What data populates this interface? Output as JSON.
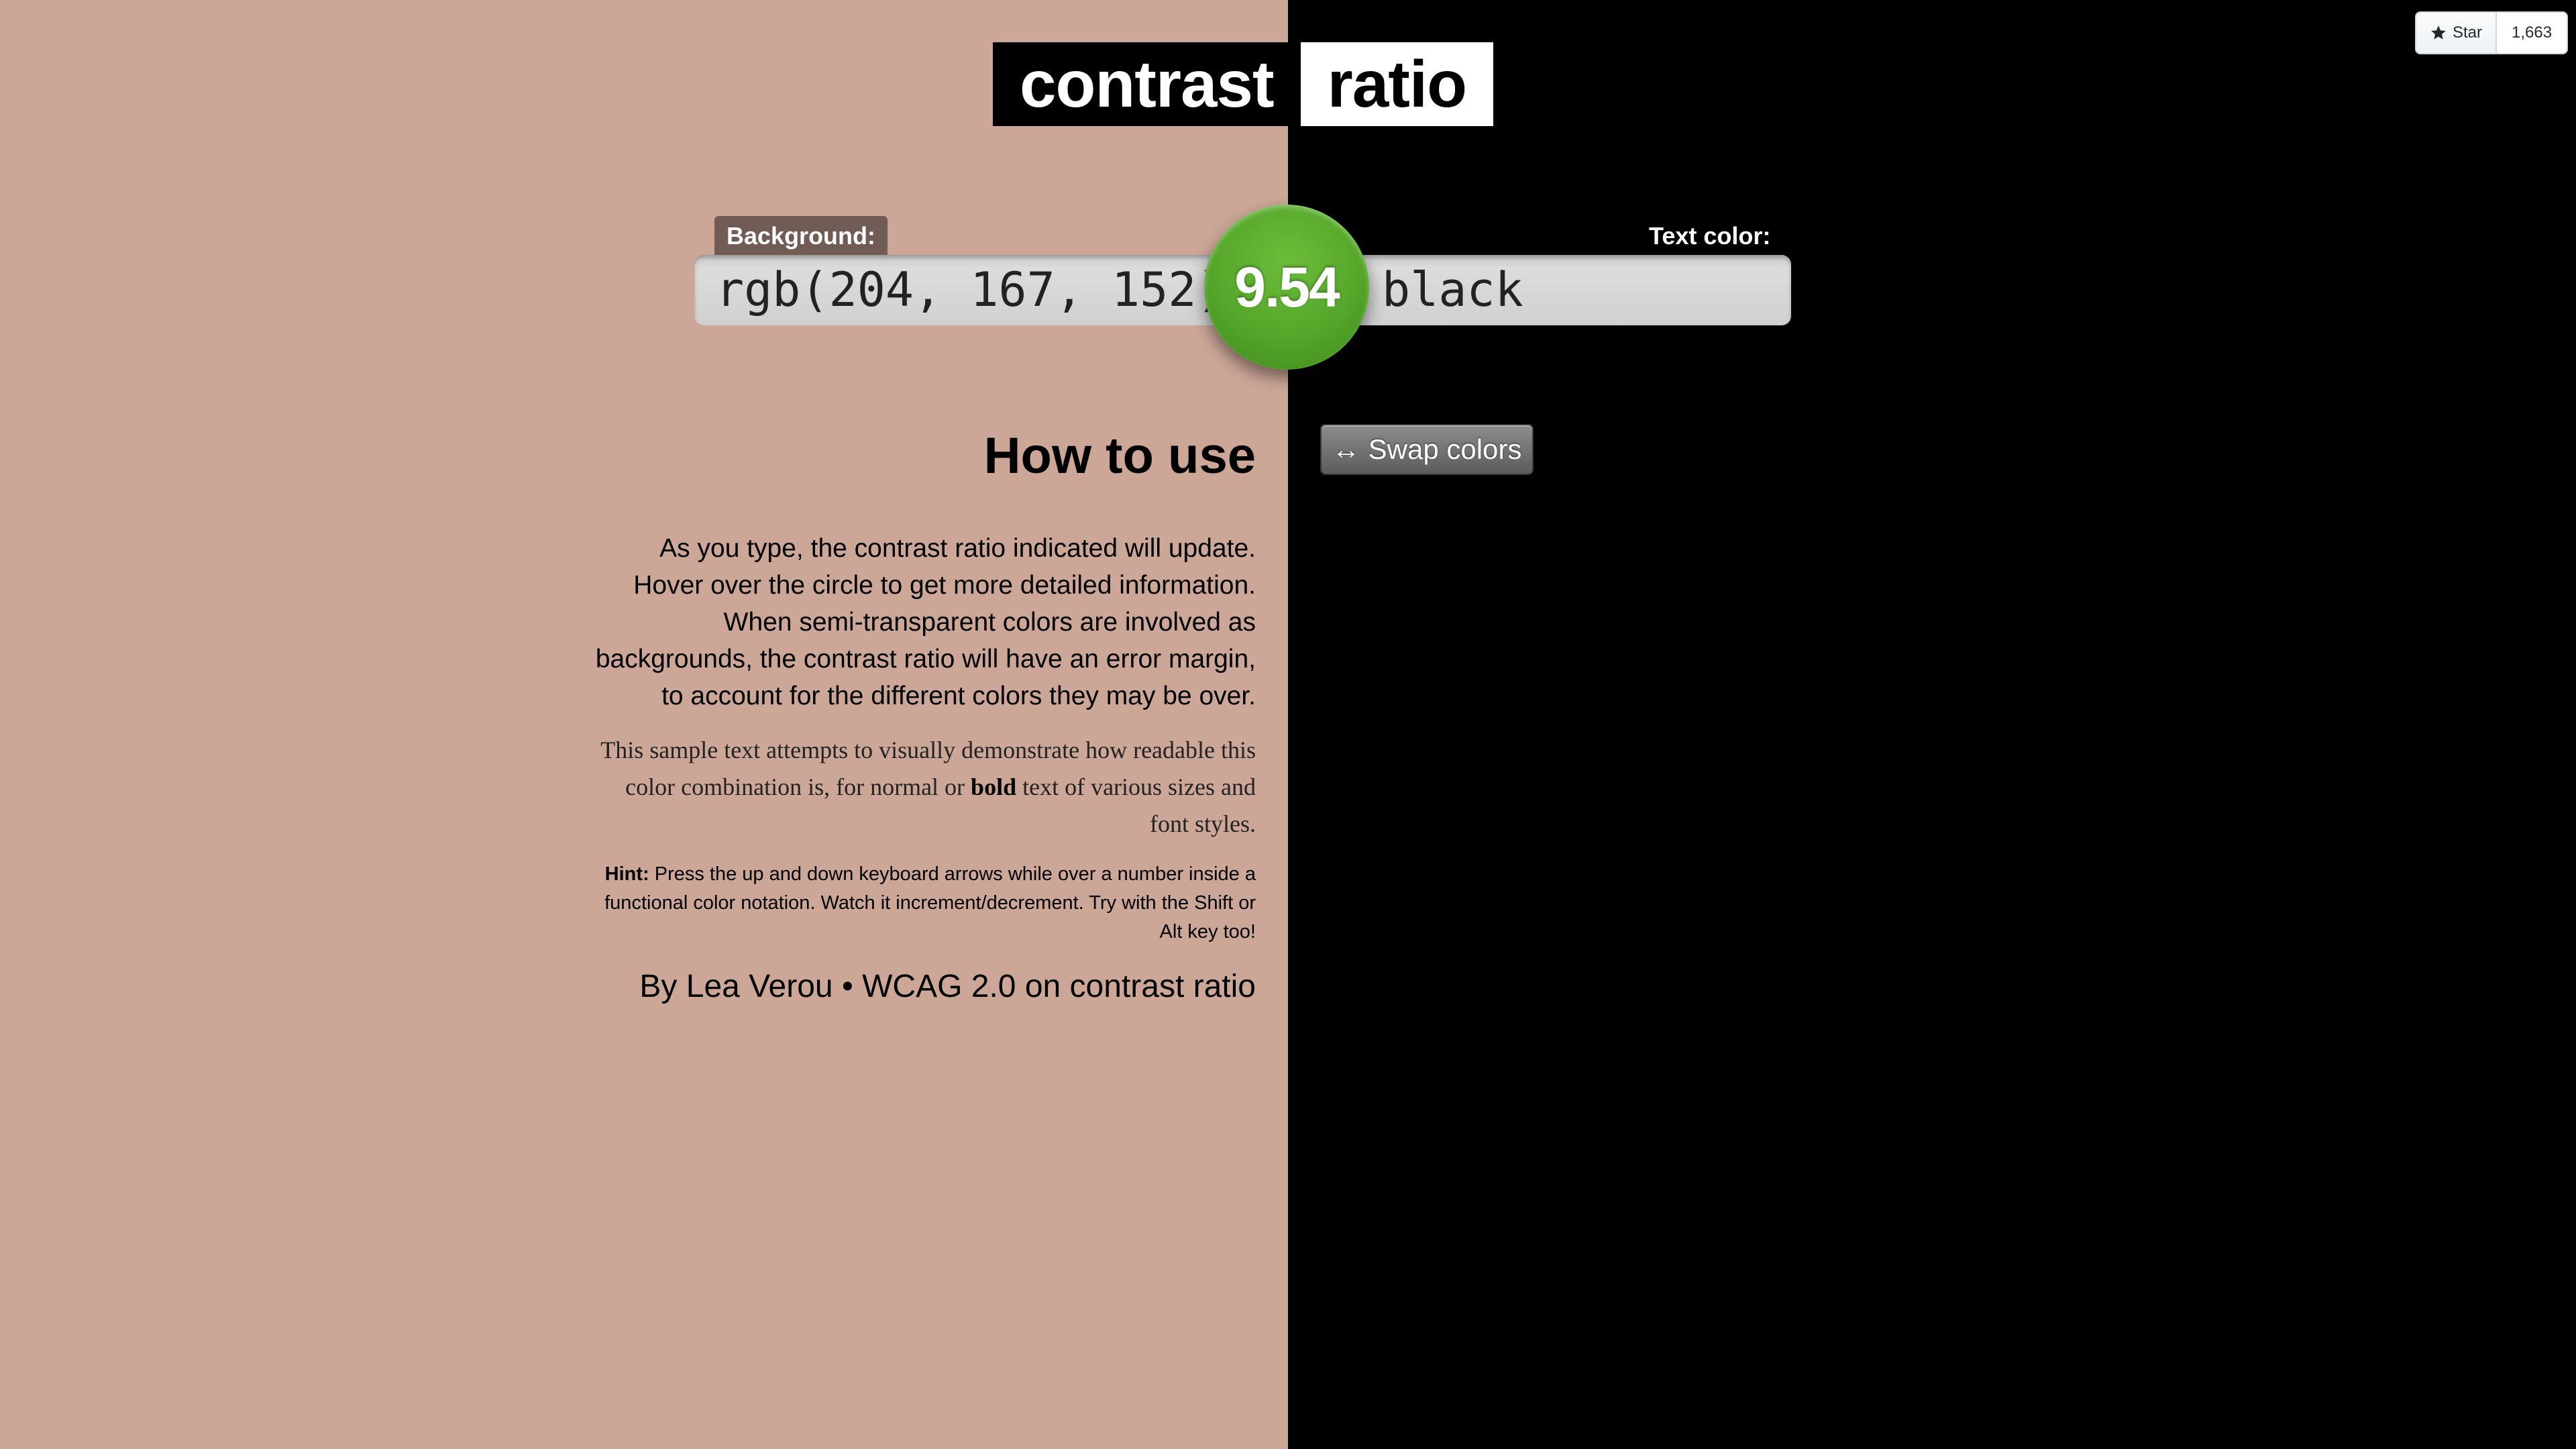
{
  "title": {
    "left": "contrast",
    "right": "ratio"
  },
  "github": {
    "star_label": "Star",
    "star_count": "1,663"
  },
  "labels": {
    "background": "Background:",
    "text_color": "Text color:"
  },
  "inputs": {
    "background_value": "rgb(204, 167, 152)",
    "text_color_value": "black"
  },
  "ratio": "9.54",
  "swap_button": {
    "icon": "↔",
    "label": "Swap colors"
  },
  "info": {
    "heading": "How to use",
    "paragraph1": "As you type, the contrast ratio indicated will update. Hover over the circle to get more detailed information. When semi-transparent colors are involved as backgrounds, the contrast ratio will have an error margin, to account for the different colors they may be over.",
    "sample_before": "This sample text attempts to visually demonstrate how readable this color combination is, for normal or ",
    "sample_bold": "bold",
    "sample_after": " text of various sizes and font styles.",
    "hint_label": "Hint:",
    "hint_text": " Press the up and down keyboard arrows while over a number inside a functional color notation. Watch it increment/decrement. Try with the Shift or Alt key too!",
    "credit_author": "By Lea Verou",
    "credit_separator": " • ",
    "credit_link": "WCAG 2.0 on contrast ratio"
  },
  "colors": {
    "background": "#cca798",
    "text": "#000000",
    "ratio_circle": "#55a62a"
  }
}
